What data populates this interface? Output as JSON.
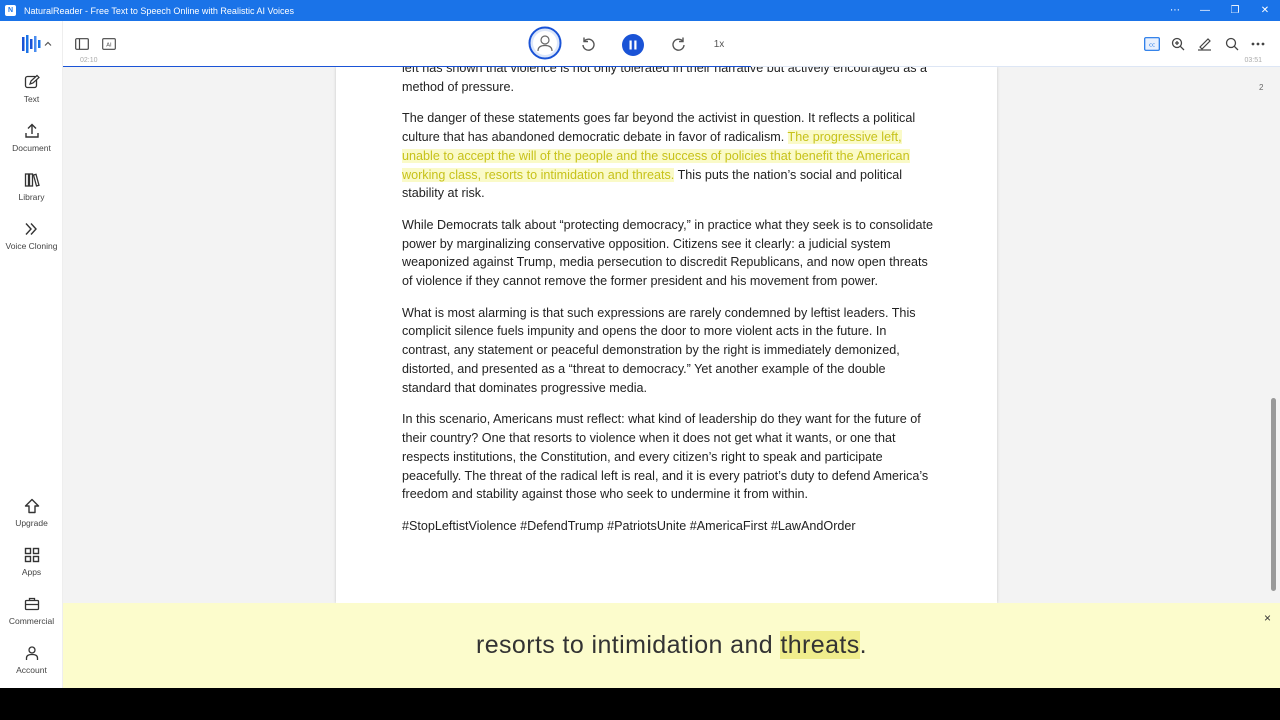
{
  "window": {
    "title": "NaturalReader - Free Text to Speech Online with Realistic AI Voices",
    "app_icon": "N",
    "controls": [
      "⋯",
      "—",
      "❐",
      "✕"
    ]
  },
  "sidebar": {
    "logo_icon": "naturalreader-logo-icon",
    "items": [
      {
        "label": "Text",
        "icon": "pencil-square-icon"
      },
      {
        "label": "Document",
        "icon": "upload-icon"
      },
      {
        "label": "Library",
        "icon": "books-icon"
      },
      {
        "label": "Voice Cloning",
        "icon": "voice-wave-icon"
      },
      {
        "label": "Upgrade",
        "icon": "upgrade-arrow-icon"
      },
      {
        "label": "Apps",
        "icon": "apps-grid-icon"
      },
      {
        "label": "Commercial",
        "icon": "briefcase-icon"
      },
      {
        "label": "Account",
        "icon": "person-icon"
      }
    ]
  },
  "player": {
    "time_elapsed": "02:10",
    "time_total": "03:51",
    "speed": "1x",
    "progress_fraction": 0.565,
    "accent_color": "#1a53d6"
  },
  "document": {
    "page_number": "2",
    "paragraphs": [
      {
        "text": "left has shown that violence is not only tolerated in their narrative but actively encouraged as a method of pressure."
      },
      {
        "before": "The danger of these statements goes far beyond the activist in question. It reflects a political culture that has abandoned democratic debate in favor of radicalism. ",
        "highlight": "The progressive left, unable to accept the will of the people and the success of policies that benefit the American working class, resorts to intimidation and threats.",
        "after": " This puts the nation’s social and political stability at risk."
      },
      {
        "text": "While Democrats talk about “protecting democracy,” in practice what they seek is to consolidate power by marginalizing conservative opposition. Citizens see it clearly: a judicial system weaponized against Trump, media persecution to discredit Republicans, and now open threats of violence if they cannot remove the former president and his movement from power."
      },
      {
        "text": "What is most alarming is that such expressions are rarely condemned by leftist leaders. This complicit silence fuels impunity and opens the door to more violent acts in the future. In contrast, any statement or peaceful demonstration by the right is immediately demonized, distorted, and presented as a “threat to democracy.” Yet another example of the double standard that dominates progressive media."
      },
      {
        "text": "In this scenario, Americans must reflect: what kind of leadership do they want for the future of their country? One that resorts to violence when it does not get what it wants, or one that respects institutions, the Constitution, and every citizen’s right to speak and participate peacefully. The threat of the radical left is real, and it is every patriot’s duty to defend America’s freedom and stability against those who seek to undermine it from within."
      },
      {
        "text": "#StopLeftistViolence #DefendTrump #PatriotsUnite #AmericaFirst #LawAndOrder"
      }
    ]
  },
  "caption": {
    "before": "resorts to intimidation and ",
    "current_word": "threats",
    "after": ".",
    "close": "×"
  }
}
